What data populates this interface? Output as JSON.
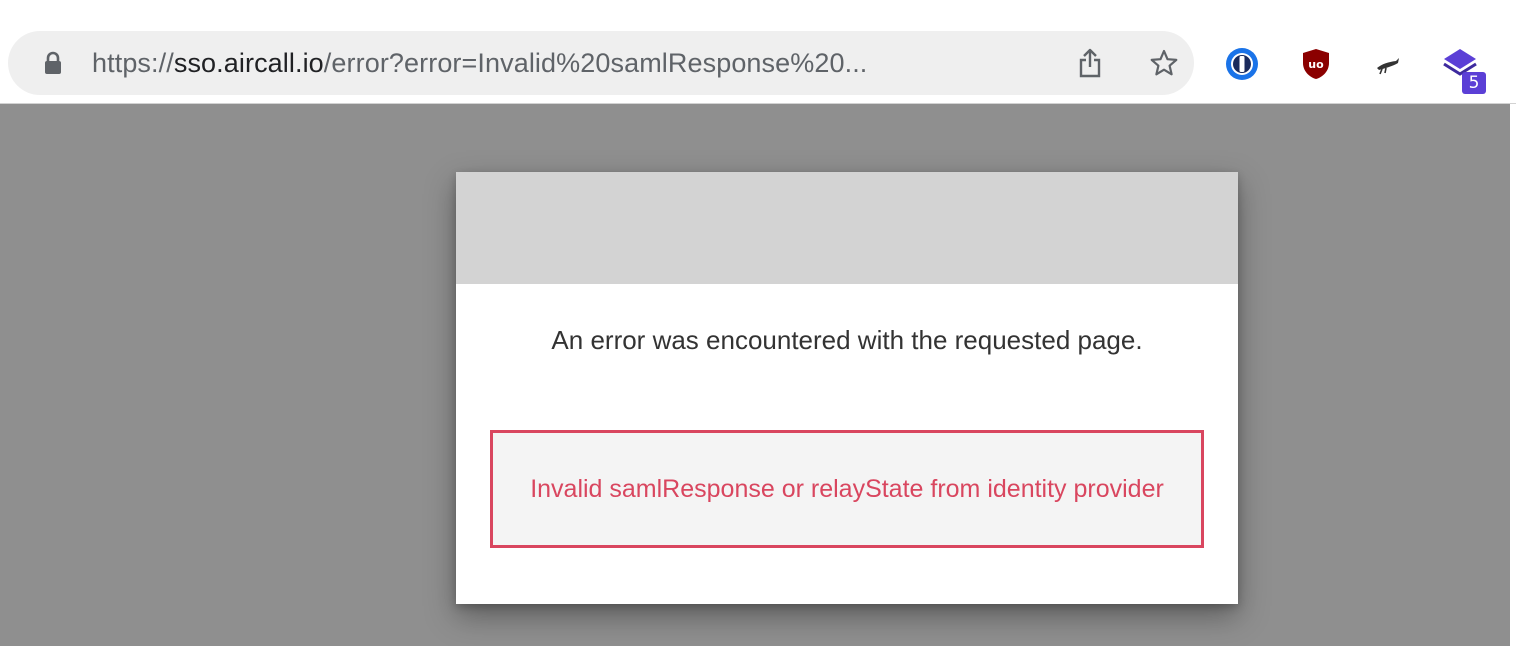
{
  "browser": {
    "url_scheme": "https://",
    "url_host": "sso.aircall.io",
    "url_rest": "/error?error=Invalid%20samlResponse%20...",
    "extensions": [
      {
        "name": "1password-icon"
      },
      {
        "name": "ublock-icon"
      },
      {
        "name": "bird-icon"
      },
      {
        "name": "stack-icon",
        "badge": "5"
      }
    ]
  },
  "dialog": {
    "message": "An error was encountered with the requested page.",
    "error": "Invalid samlResponse or relayState from identity provider"
  },
  "colors": {
    "overlay": "#8f8f8f",
    "header": "#d3d3d3",
    "error": "#d9465f",
    "error_bg": "#f4f4f4",
    "badge": "#5b3fd6"
  }
}
